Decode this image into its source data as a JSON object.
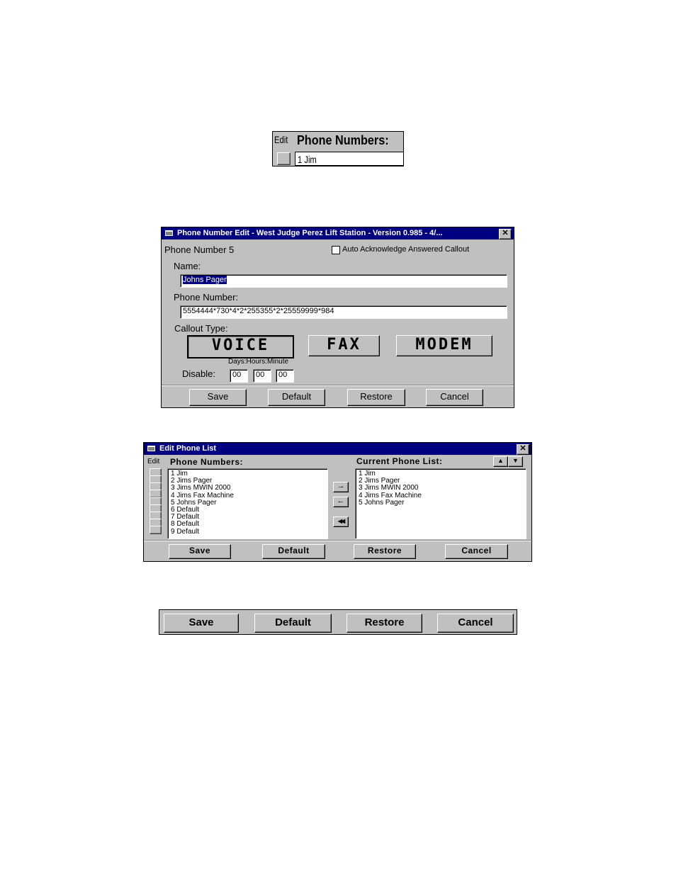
{
  "snippet": {
    "edit_label": "Edit",
    "heading": "Phone Numbers:",
    "first_item": "1 Jim"
  },
  "phone_edit": {
    "title": "Phone Number Edit - West Judge Perez Lift Station - Version 0.985 - 4/...",
    "close_glyph": "✕",
    "phone_number_label": "Phone Number 5",
    "auto_ack_label": "Auto Acknowledge Answered Callout",
    "name_label": "Name:",
    "name_value": "Johns Pager",
    "phone_label": "Phone Number:",
    "phone_value": "5554444*730*4*2*255355*2*25559999*984",
    "callout_label": "Callout Type:",
    "callout_types": [
      "VOICE",
      "FAX",
      "MODEM"
    ],
    "dhm_label": "Days:Hours:Minute",
    "disable_label": "Disable:",
    "days": "00",
    "hours": "00",
    "minutes": "00",
    "buttons": {
      "save": "Save",
      "default": "Default",
      "restore": "Restore",
      "cancel": "Cancel"
    }
  },
  "phone_list": {
    "title": "Edit Phone List",
    "close_glyph": "✕",
    "edit_label": "Edit",
    "numbers_label": "Phone Numbers:",
    "current_label": "Current Phone List:",
    "numbers": [
      "1 Jim",
      "2 Jims Pager",
      "3 Jims MWIN 2000",
      "4 Jims Fax Machine",
      "5 Johns Pager",
      "6 Default",
      "7 Default",
      "8 Default",
      "9 Default"
    ],
    "current": [
      "1 Jim",
      "2 Jims Pager",
      "3 Jims MWIN 2000",
      "4 Jims Fax Machine",
      "5 Johns Pager"
    ],
    "icons": {
      "add": "→",
      "remove": "←",
      "remove_all": "◀◀",
      "up": "▲",
      "down": "▼"
    },
    "buttons": {
      "save": "Save",
      "default": "Default",
      "restore": "Restore",
      "cancel": "Cancel"
    }
  },
  "button_bar": {
    "buttons": {
      "save": "Save",
      "default": "Default",
      "restore": "Restore",
      "cancel": "Cancel"
    }
  }
}
